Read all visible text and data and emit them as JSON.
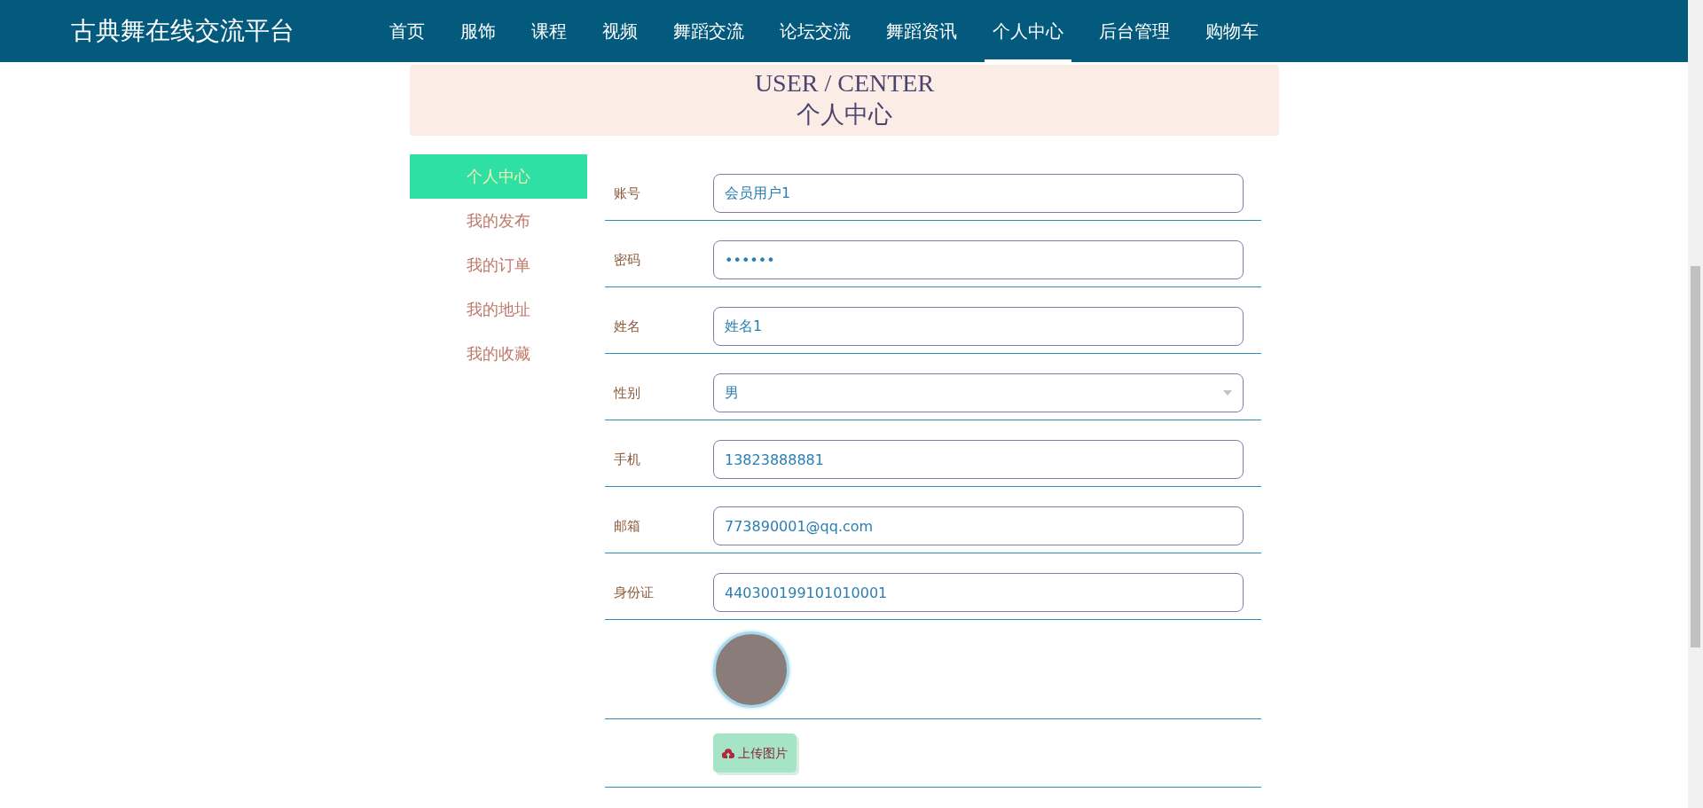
{
  "navbar": {
    "brand": "古典舞在线交流平台",
    "items": [
      {
        "label": "首页",
        "selected": false
      },
      {
        "label": "服饰",
        "selected": false
      },
      {
        "label": "课程",
        "selected": false
      },
      {
        "label": "视频",
        "selected": false
      },
      {
        "label": "舞蹈交流",
        "selected": false
      },
      {
        "label": "论坛交流",
        "selected": false
      },
      {
        "label": "舞蹈资讯",
        "selected": false
      },
      {
        "label": "个人中心",
        "selected": true
      },
      {
        "label": "后台管理",
        "selected": false
      },
      {
        "label": "购物车",
        "selected": false
      }
    ]
  },
  "banner": {
    "title": "USER / CENTER",
    "subtitle": "个人中心"
  },
  "sidebar": {
    "items": [
      {
        "label": "个人中心",
        "selected": true
      },
      {
        "label": "我的发布",
        "selected": false
      },
      {
        "label": "我的订单",
        "selected": false
      },
      {
        "label": "我的地址",
        "selected": false
      },
      {
        "label": "我的收藏",
        "selected": false
      }
    ]
  },
  "form": {
    "fields": [
      {
        "kind": "text",
        "label": "账号",
        "value": "会员用户1"
      },
      {
        "kind": "password",
        "label": "密码",
        "value": "••••••"
      },
      {
        "kind": "text",
        "label": "姓名",
        "value": "姓名1"
      },
      {
        "kind": "select",
        "label": "性别",
        "value": "男"
      },
      {
        "kind": "text",
        "label": "手机",
        "value": "13823888881"
      },
      {
        "kind": "text",
        "label": "邮箱",
        "value": "773890001@qq.com"
      },
      {
        "kind": "text",
        "label": "身份证",
        "value": "440300199101010001"
      },
      {
        "kind": "avatar"
      },
      {
        "kind": "upload",
        "button": "上传图片"
      }
    ]
  }
}
